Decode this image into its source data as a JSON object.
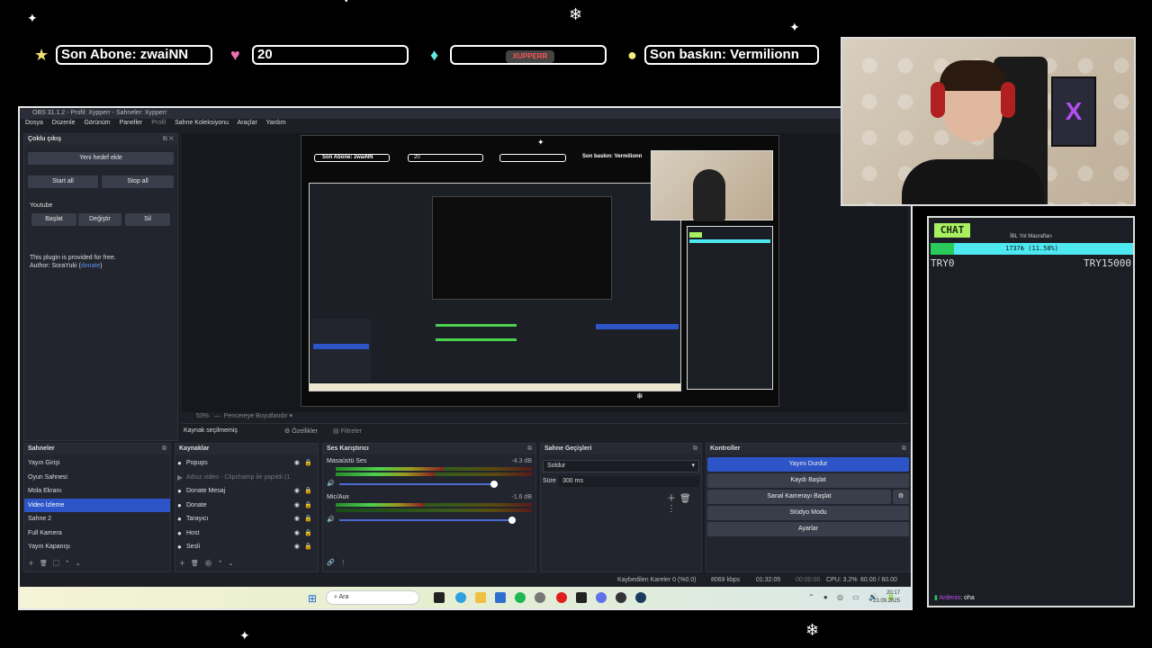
{
  "overlay": {
    "last_sub": "Son Abone: zwaiNN",
    "follower_count": "20",
    "youtube_badge": "XUPPERR",
    "last_raid": "Son baskın: Vermilionn"
  },
  "window": {
    "title": "OBS 31.1.2 - Profil: Xypperr - Sahneler: Xypperr",
    "menu": [
      "Dosya",
      "Düzenle",
      "Görünüm",
      "Paneller",
      "Profil",
      "Sahne Koleksiyonu",
      "Araçlar",
      "Yardım"
    ]
  },
  "multistream": {
    "title": "Çoklu çıkış",
    "new_target": "Yeni hedef ekle",
    "start_all": "Start all",
    "stop_all": "Stop all",
    "youtube_label": "Youtube",
    "start": "Başlat",
    "change": "Değiştir",
    "delete": "Sil",
    "plugin_note": "This plugin is provided for free.",
    "author": "Author: SoraYuki (",
    "donate": "donate",
    "author_end": ")"
  },
  "preview_footer": {
    "zoom": "53%",
    "fit": "Pencereye Boyutlandır",
    "no_source": "Kaynak seçilmemiş",
    "properties": "Özellikler",
    "filters": "Filtreler"
  },
  "scenes": {
    "title": "Sahneler",
    "items": [
      "Yayın Girişi",
      "Oyun Sahnesi",
      "Mola Ekranı",
      "Video İzleme",
      "Sahne 2",
      "Full Kamera",
      "Yayın Kapanışı"
    ],
    "selected_index": 3
  },
  "sources": {
    "title": "Kaynaklar",
    "items": [
      "Popups",
      "Adsız video - Clipchamp ile yapıldı (1",
      "Donate Mesaj",
      "Donate",
      "Tarayıcı",
      "Host",
      "Sesli"
    ]
  },
  "mixer": {
    "title": "Ses Karıştırıcı",
    "channels": [
      {
        "name": "Masaüstü Ses",
        "db": "-4.3 dB",
        "level": 0.55
      },
      {
        "name": "Mic/Aux",
        "db": "-1.6 dB",
        "level": 0.45
      }
    ],
    "scale": [
      "-60",
      "-55",
      "-50",
      "-45",
      "-40",
      "-35",
      "-30",
      "-25",
      "-20",
      "-15",
      "-10",
      "-5",
      "0"
    ]
  },
  "transitions": {
    "title": "Sahne Geçişleri",
    "type": "Soldur",
    "duration_label": "Süre",
    "duration": "300 ms"
  },
  "controls": {
    "title": "Kontroller",
    "stop_stream": "Yayını Durdur",
    "start_record": "Kaydı Başlat",
    "virtual_cam": "Sanal Kamerayı Başlat",
    "studio": "Stüdyo Modu",
    "settings": "Ayarlar"
  },
  "status": {
    "dropped": "Kaybedilen Kareler 0 (%0.0)",
    "bitrate": "8069 kbps",
    "live_time": "01:32:05",
    "rec_time": "00:00:00",
    "cpu": "CPU: 3.2%",
    "fps": "60.00 / 60.00 FPS"
  },
  "taskbar": {
    "search": "Ara",
    "time": "20:17",
    "date": "23.09.2025"
  },
  "chat": {
    "title": "CHAT",
    "goal_label": "İBL Yol Masrafları",
    "goal_text": "1737₺ (11.58%)",
    "goal_progress": 0.1158,
    "min": "TRY0",
    "max": "TRY15000",
    "message_user": "Ardenis",
    "message_text": ": oha"
  },
  "colors": {
    "accent": "#2d55c8",
    "chat_bar": "#4de8f0",
    "chat_fill": "#29cc5a",
    "chat_title_bg": "#a8f060"
  }
}
